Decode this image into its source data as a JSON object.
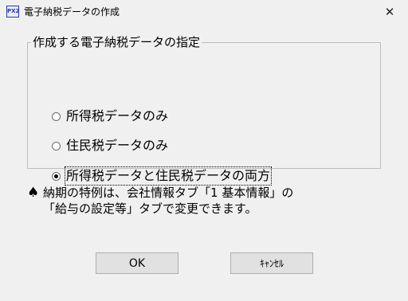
{
  "window": {
    "icon_text": "PX2",
    "title": "電子納税データの作成",
    "close_glyph": "✕"
  },
  "group": {
    "legend": "作成する電子納税データの指定",
    "options": [
      {
        "label": "所得税データのみ",
        "checked": false
      },
      {
        "label": "住民税データのみ",
        "checked": false
      },
      {
        "label": "所得税データと住民税データの両方",
        "checked": true
      }
    ]
  },
  "note": {
    "symbol": "♠",
    "line1": "納期の特例は、会社情報タブ「1 基本情報」の",
    "line2": "「給与の設定等」タブで変更できます。"
  },
  "buttons": {
    "ok": "OK",
    "cancel": "ｷｬﾝｾﾙ"
  }
}
